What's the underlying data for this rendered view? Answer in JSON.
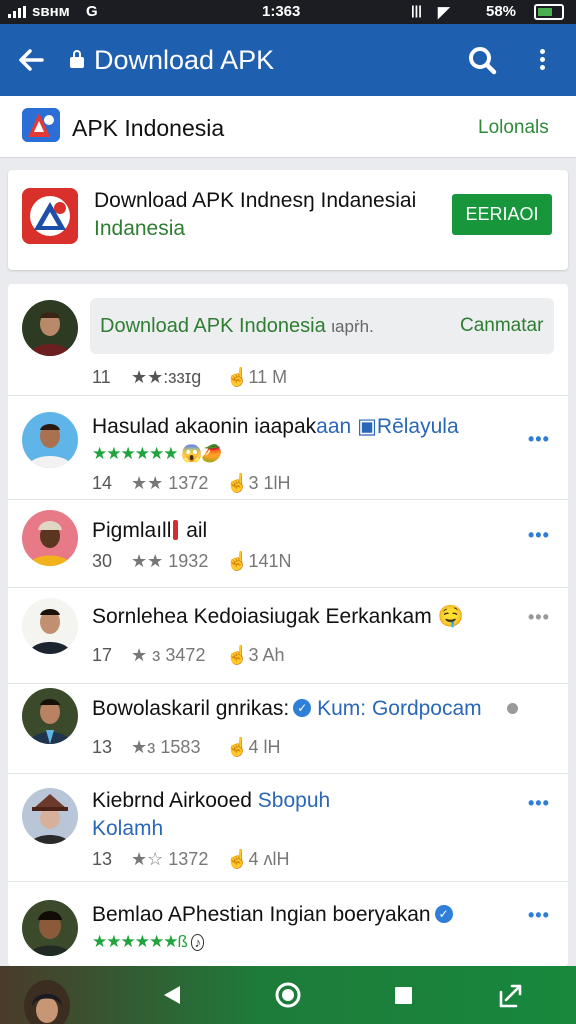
{
  "status_bar": {
    "carrier": "ѕвнм",
    "g": "G",
    "time": "1:363",
    "battery": "58%",
    "battery_level_percent": 58
  },
  "app_bar": {
    "back_icon": "arrow-left-icon",
    "title": "Download APK",
    "actions": [
      "search-icon",
      "more-vertical-icon"
    ]
  },
  "brand": {
    "name": "APK Indonesia",
    "locale_link": "Lolonals"
  },
  "featured": {
    "line1": "Download APK Indnesŋ Indanesiai",
    "line2": "Indanesia",
    "button": "EERIAOI"
  },
  "comment_post": {
    "text": "Download APK Indonesia",
    "suffix": "ιapṙh.",
    "action": "Canmatar",
    "meta_count": "11",
    "meta_stars": "★★:ɜɜɪg",
    "meta_likes": "☝11 M"
  },
  "posts": [
    {
      "title": "Hasulad akaonin iaapak",
      "title_blue": "aan",
      "badge": "Rēlayula",
      "stars": "★★★★★★",
      "emoji": "😱🥭",
      "count": "14",
      "rating": "★★ 1372",
      "likes": "3 1lH"
    },
    {
      "title": "Pigmlaıll",
      "title_tail": "ail",
      "count": "30",
      "rating": "★★ 1932",
      "likes": "141N"
    },
    {
      "title": "Sornlehea Kedoiasiugak Eerkankam",
      "emoji": "🤤",
      "count": "17",
      "rating": "★ ɜ 3472",
      "likes": "3 Ah"
    },
    {
      "title": "Bowolaskaril gnrikas:",
      "title_blue": "Kum: Gordpocam",
      "count": "13",
      "rating": "★ɜ 1583",
      "likes": "4 lH"
    },
    {
      "title": "Kiebrnd Airkooed",
      "title_blue": "Sbopuh",
      "line2": "Kolamh",
      "count": "13",
      "rating": "★☆ 1372",
      "likes": "4 ʌlH"
    },
    {
      "title": "Bemlao APhestian Ingian boeryakan",
      "stars": "★★★★★★ß",
      "emoji": "♪",
      "count": "",
      "rating": "",
      "likes": ""
    }
  ],
  "bottom_nav": [
    "back-icon",
    "home-icon",
    "recents-icon",
    "share-icon"
  ],
  "colors": {
    "app_bar": "#1f5fb0",
    "accent_green": "#17963c",
    "link_blue": "#2a67b8",
    "star_green": "#1fa33a"
  }
}
